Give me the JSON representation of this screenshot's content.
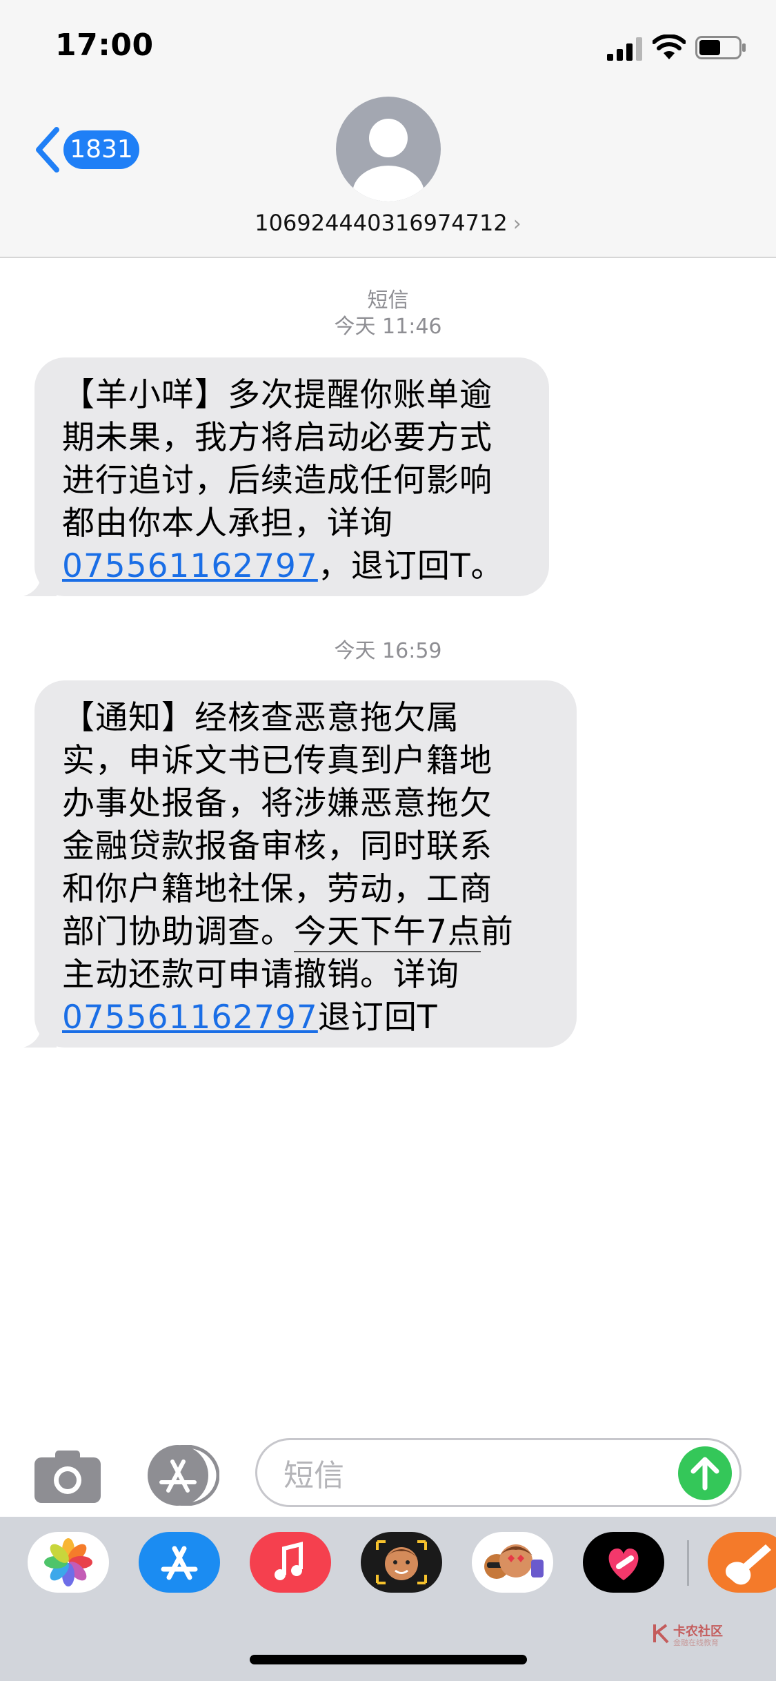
{
  "status_bar": {
    "time": "17:00"
  },
  "header": {
    "back_badge": "1831",
    "contact_number": "106924440316974712",
    "contact_chevron": "›"
  },
  "conversation": {
    "service_label": "短信",
    "first_timestamp": "今天 11:46",
    "message1": {
      "line1": "【羊小咩】多次提醒你账单逾",
      "line2": "期未果，我方将启动必要方式",
      "line3": "进行追讨，后续造成任何影响",
      "line4": "都由你本人承担，详询",
      "link": "075561162797",
      "tail_text": "，退订回T。"
    },
    "second_timestamp": "今天 16:59",
    "message2": {
      "line1": "【通知】经核查恶意拖欠属",
      "line2": "实，申诉文书已传真到户籍地",
      "line3": "办事处报备，将涉嫌恶意拖欠",
      "line4": "金融贷款报备审核，同时联系",
      "line5": "和你户籍地社保，劳动，工商",
      "line6_start": "部门协助调查。",
      "line6_underlined": "今天下午7点",
      "line6_end": "前",
      "line7": "主动还款可申请撤销。详询",
      "link": "075561162797",
      "tail_text": "退订回T"
    }
  },
  "composer": {
    "placeholder": "短信"
  },
  "app_drawer": {
    "apps": [
      "photos-icon",
      "app-store-icon",
      "music-icon",
      "memoji-icon",
      "memoji-stickers-icon",
      "digital-touch-icon",
      "garageband-icon"
    ]
  },
  "watermark": {
    "title": "卡农社区",
    "subtitle": "金融在线教育"
  },
  "colors": {
    "accent": "#1f7ff6",
    "bubble": "#e9e9eb",
    "link": "#1a6ee6",
    "send": "#34c759"
  }
}
